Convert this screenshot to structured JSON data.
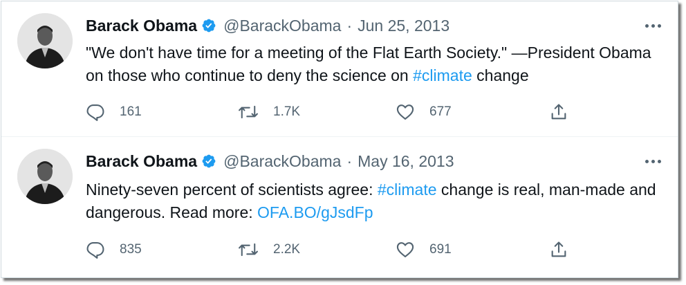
{
  "tweets": [
    {
      "name": "Barack Obama",
      "handle": "@BarackObama",
      "separator": "·",
      "date": "Jun 25, 2013",
      "text_before": "\"We don't have time for a meeting of the Flat Earth Society.\" —President Obama on those who continue to deny the science on ",
      "hashtag": "#climate",
      "text_after": " change",
      "replies": "161",
      "retweets": "1.7K",
      "likes": "677"
    },
    {
      "name": "Barack Obama",
      "handle": "@BarackObama",
      "separator": "·",
      "date": "May 16, 2013",
      "text_before": "Ninety-seven percent of scientists agree: ",
      "hashtag": "#climate",
      "text_middle": " change is real, man-made and dangerous. Read more: ",
      "link": "OFA.BO/gJsdFp",
      "replies": "835",
      "retweets": "2.2K",
      "likes": "691"
    }
  ],
  "icons": {
    "verified": "verified-badge-icon",
    "more": "more-options-icon",
    "reply": "reply-icon",
    "retweet": "retweet-icon",
    "like": "heart-icon",
    "share": "share-icon"
  },
  "colors": {
    "accent": "#1d9bf0",
    "text": "#0f1419",
    "secondary": "#536471",
    "border": "#cfd9de"
  }
}
